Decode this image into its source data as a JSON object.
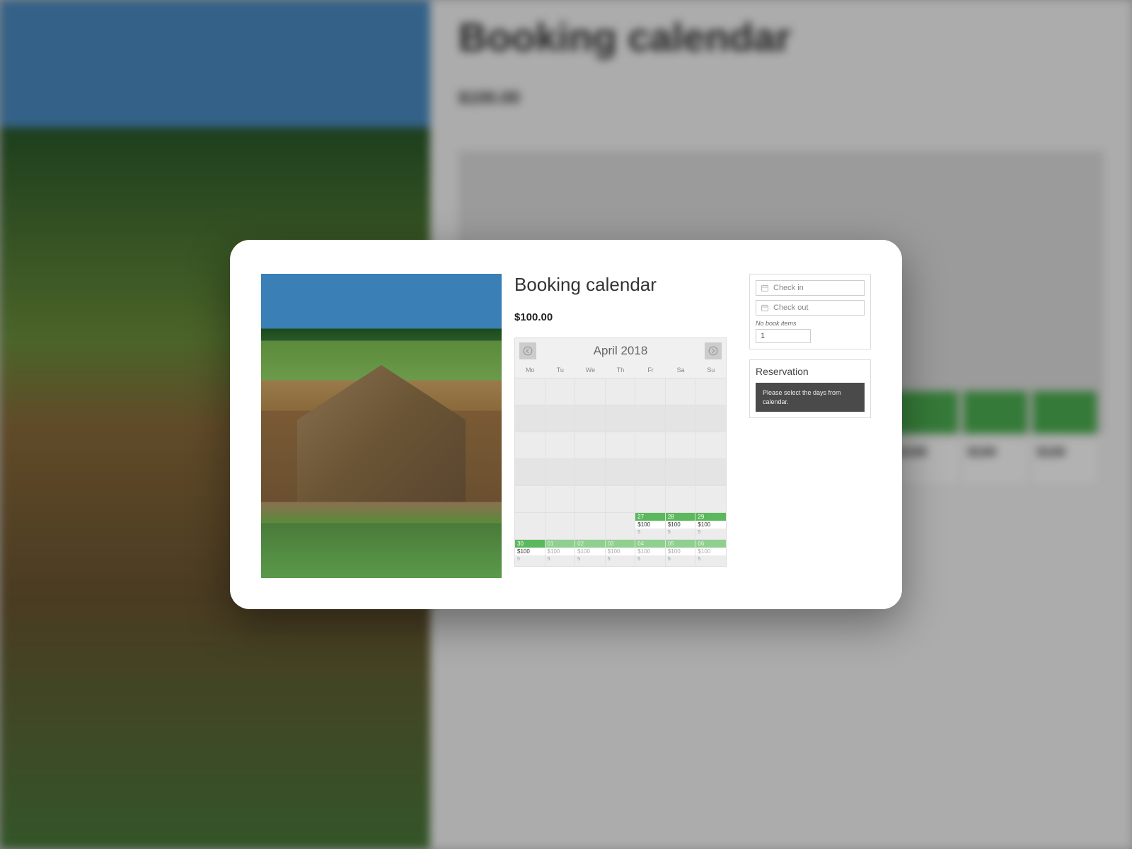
{
  "backdrop": {
    "title": "Booking calendar",
    "price": "$100.00",
    "cell_price": "$100"
  },
  "modal": {
    "title": "Booking calendar",
    "price": "$100.00"
  },
  "calendar": {
    "month": "April 2018",
    "dow": [
      "Mo",
      "Tu",
      "We",
      "Th",
      "Fr",
      "Sa",
      "Su"
    ],
    "available": [
      {
        "day": "27",
        "price": "$100",
        "faded": false
      },
      {
        "day": "28",
        "price": "$100",
        "faded": false
      },
      {
        "day": "29",
        "price": "$100",
        "faded": false
      },
      {
        "day": "30",
        "price": "$100",
        "faded": false
      },
      {
        "day": "01",
        "price": "$100",
        "faded": true
      },
      {
        "day": "02",
        "price": "$100",
        "faded": true
      },
      {
        "day": "03",
        "price": "$100",
        "faded": true
      },
      {
        "day": "04",
        "price": "$100",
        "faded": true
      },
      {
        "day": "05",
        "price": "$100",
        "faded": true
      },
      {
        "day": "06",
        "price": "$100",
        "faded": true
      }
    ]
  },
  "form": {
    "checkin_placeholder": "Check in",
    "checkout_placeholder": "Check out",
    "items_label": "No book items",
    "items_value": "1"
  },
  "reservation": {
    "title": "Reservation",
    "message": "Please select the days from calendar."
  }
}
